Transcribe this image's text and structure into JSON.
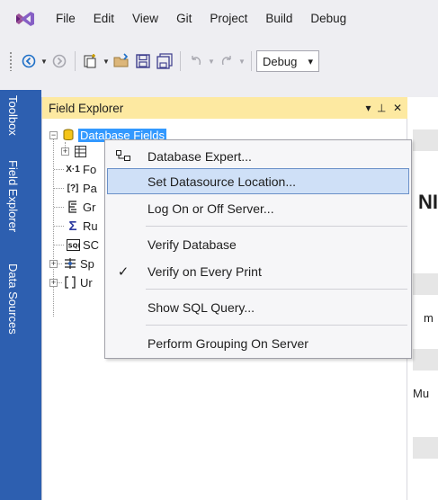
{
  "menubar": {
    "items": [
      "File",
      "Edit",
      "View",
      "Git",
      "Project",
      "Build",
      "Debug"
    ]
  },
  "toolbar": {
    "config_select": "Debug",
    "config_arrow": "▾"
  },
  "side_tabs": [
    "Toolbox",
    "Field Explorer",
    "Data Sources"
  ],
  "field_explorer": {
    "title": "Field Explorer",
    "pin_glyph": "⊣",
    "close_glyph": "✕",
    "dropdown_glyph": "▾",
    "tree": {
      "database_fields": "Database Fields",
      "rows": [
        {
          "label": "",
          "icon": "table-icon"
        },
        {
          "label": "Fo",
          "icon": "formula-icon"
        },
        {
          "label": "Pa",
          "icon": "parameter-icon"
        },
        {
          "label": "Gr",
          "icon": "group-icon"
        },
        {
          "label": "Ru",
          "icon": "running-total-icon"
        },
        {
          "label": "SC",
          "icon": "sql-expression-icon"
        },
        {
          "label": "Sp",
          "icon": "special-fields-icon"
        },
        {
          "label": "Ur",
          "icon": "unbound-fields-icon"
        }
      ]
    }
  },
  "doc_area": {
    "heading_fragment": "NI",
    "text_fragment_1": "m",
    "text_fragment_2": "Mu"
  },
  "context_menu": {
    "items": [
      {
        "label": "Database Expert...",
        "icon": "database-expert-icon"
      },
      {
        "label": "Set Datasource Location..."
      },
      {
        "label": "Log On or Off Server..."
      },
      {
        "label": "Verify Database"
      },
      {
        "label": "Verify on Every Print",
        "checked": true,
        "check_glyph": "✓"
      },
      {
        "label": "Show SQL Query..."
      },
      {
        "label": "Perform Grouping On Server"
      }
    ],
    "hovered_item": "Set Datasource Location..."
  },
  "colors": {
    "side_strip": "#2d5fb0",
    "panel_title": "#fde9a1",
    "selection": "#3399ff",
    "menu_hover": "#cfe0f7"
  }
}
